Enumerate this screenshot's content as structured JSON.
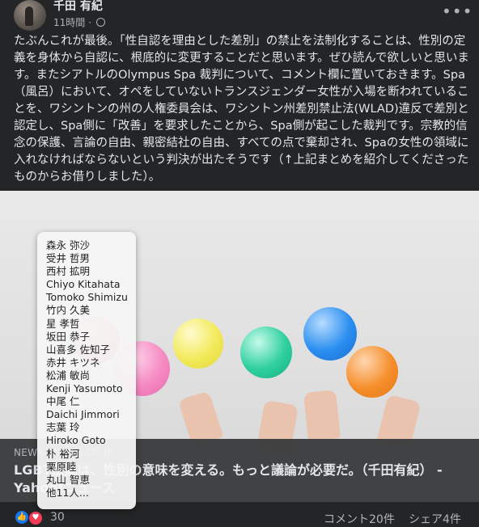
{
  "post": {
    "author": "千田 有紀",
    "time": "11時間",
    "text": "たぶんこれが最後。「性自認を理由とした差別」の禁止を法制化することは、性別の定義を身体から自認に、根底的に変更することだと思います。ぜひ読んで欲しいと思います。またシアトルのOlympus Spa 裁判について、コメント欄に置いておきます。Spa（風呂）において、オペをしていないトランスジェンダー女性が入場を断われていることを、ワシントンの州の人権委員会は、ワシントン州差別禁止法(WLAD)違反で差別と認定し、Spa側に「改善」を要求したことから、Spa側が起こした裁判です。宗教的信念の保護、言論の自由、親密結社の自由、すべての点で棄却され、Spaの女性の領域に入れなければならないという判決が出たそうです（↑上記まとめを紹介してくださったものからお借りしました）。"
  },
  "link": {
    "source": "NEWS.YAHOO.CO.JP",
    "title": "LGBT法案は、性別の意味を変える。もっと議論が必要だ。（千田有紀） - Yahoo!ニュース"
  },
  "reactions_tooltip": {
    "names": [
      "森永 弥沙",
      "受井 哲男",
      "西村 拡明",
      "Chiyo Kitahata",
      "Tomoko Shimizu",
      "竹内 久美",
      "星 孝哲",
      "坂田 恭子",
      "山喜多 佐知子",
      "赤井 キツネ",
      "松浦 敏尚",
      "Kenji Yasumoto",
      "中尾 仁",
      "Daichi Jimmori",
      "志葉 玲",
      "Hiroko Goto",
      "朴 裕河",
      "栗原睦",
      "丸山 智恵",
      "他11人..."
    ]
  },
  "footer": {
    "reaction_count": "30",
    "comments": "コメント20件",
    "shares": "シェア4件"
  },
  "icons": {
    "like": "like-icon",
    "heart": "heart-icon",
    "more": "more-options-icon",
    "globe": "globe-icon"
  },
  "colors": {
    "background": "#242526",
    "like": "#1877f2",
    "heart": "#f33e58"
  }
}
